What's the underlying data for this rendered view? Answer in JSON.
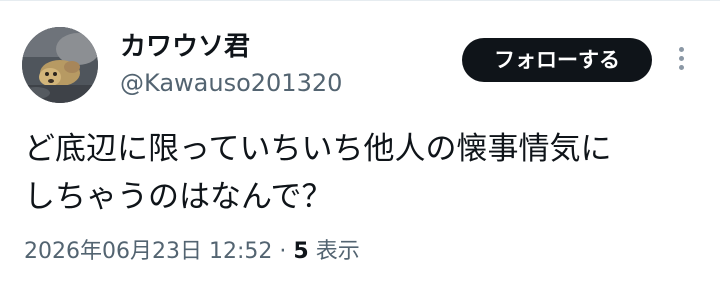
{
  "user": {
    "display_name": "カワウソ君",
    "handle": "@Kawauso201320",
    "avatar_icon": "otter-avatar-photo"
  },
  "actions": {
    "follow_label": "フォローする",
    "more_icon": "more-vertical-icon"
  },
  "tweet": {
    "text_lines": [
      "ど底辺に限っていちいち他人の懐事情気に",
      "しちゃうのはなんで？"
    ]
  },
  "meta": {
    "datetime": "2026年06月23日 12:52",
    "separator": "·",
    "views_count": "5",
    "views_label": "表示"
  },
  "colors": {
    "text": "#0f1419",
    "secondary_text": "#536471",
    "button_bg": "#0f1419",
    "button_text": "#ffffff",
    "divider": "#e6ecf0"
  }
}
